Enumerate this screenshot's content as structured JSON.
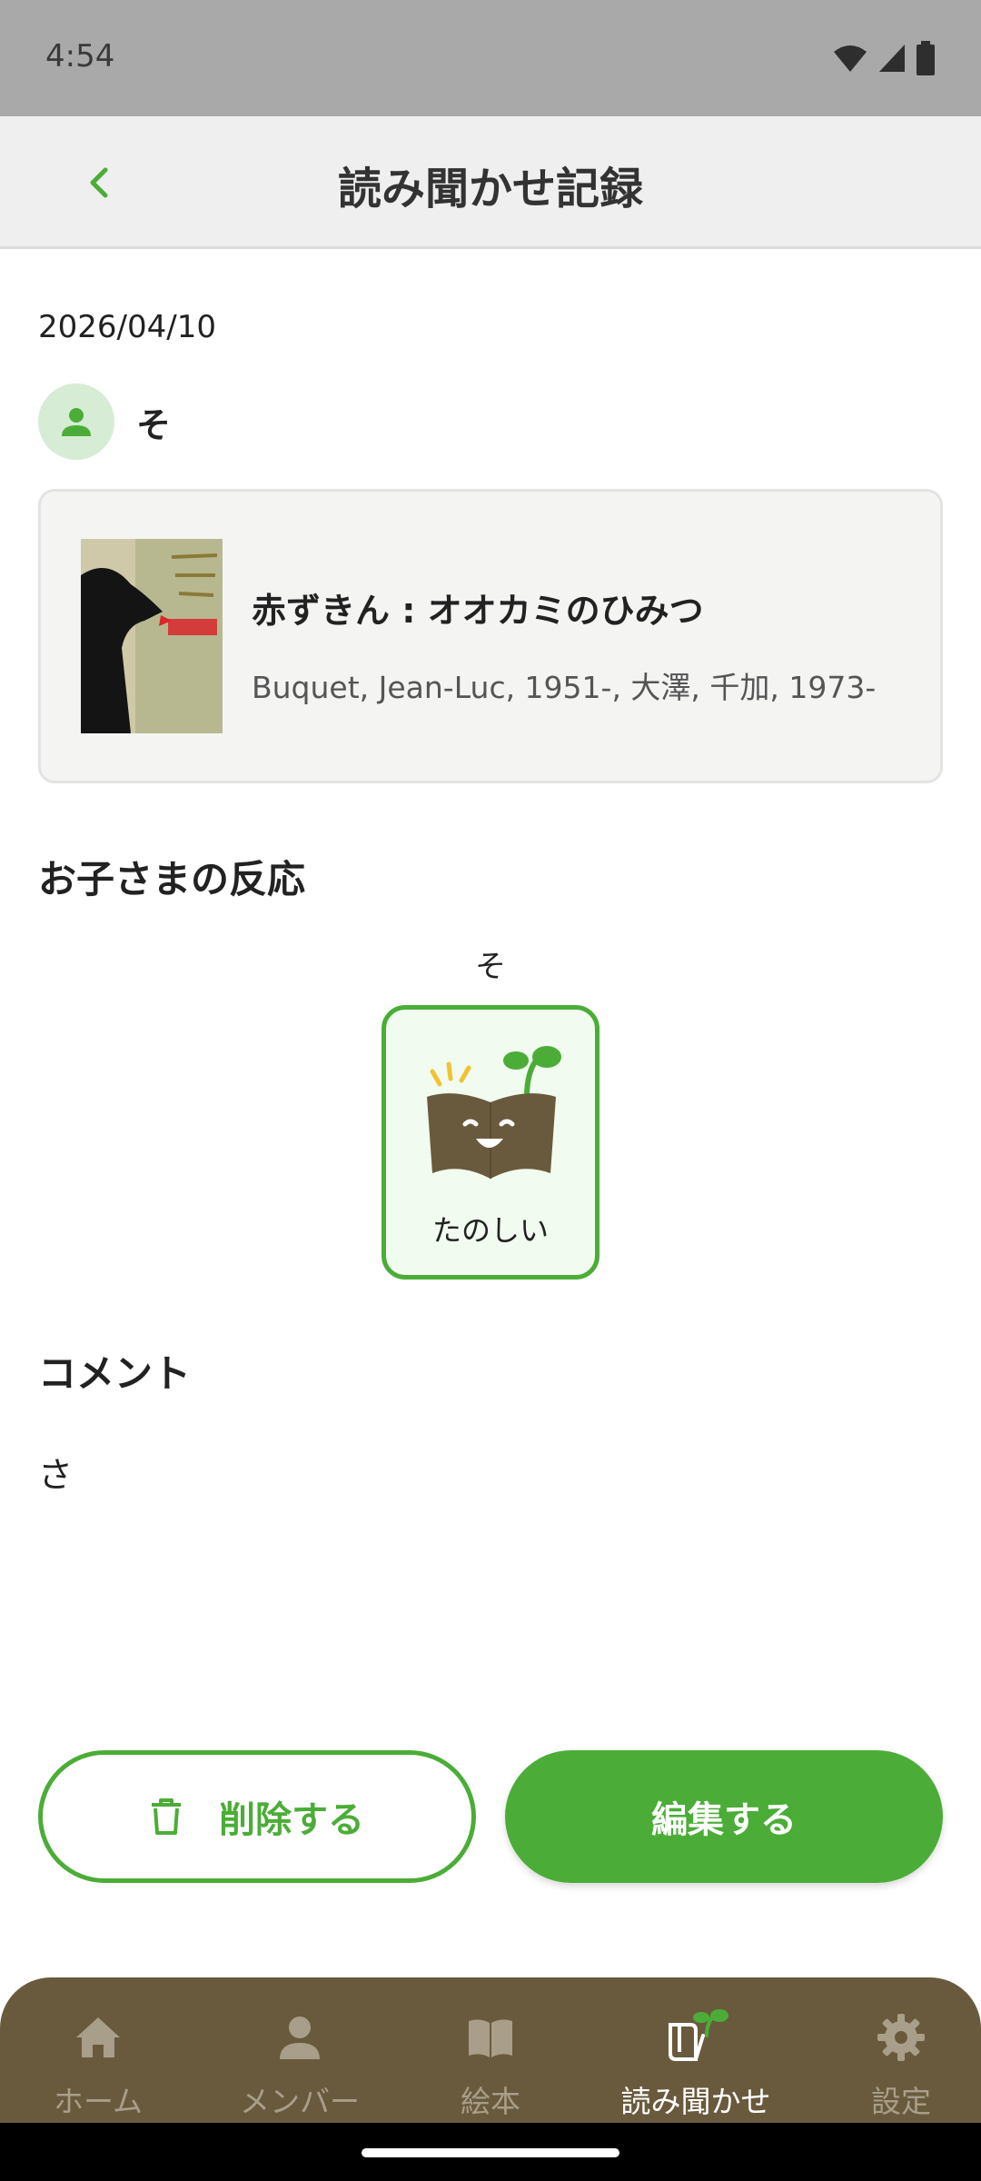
{
  "status_bar": {
    "time": "4:54"
  },
  "app_bar": {
    "title": "読み聞かせ記録"
  },
  "record": {
    "date": "2026/04/10",
    "member_name": "そ"
  },
  "book": {
    "title": "赤ずきん : オオカミのひみつ",
    "author": "Buquet, Jean-Luc, 1951-, 大澤, 千加, 1973-"
  },
  "reactions": {
    "heading": "お子さまの反応",
    "member_name": "そ",
    "reaction_label": "たのしい"
  },
  "comment": {
    "heading": "コメント",
    "text": "さ"
  },
  "actions": {
    "delete_label": "削除する",
    "edit_label": "編集する"
  },
  "bottom_nav": {
    "items": [
      {
        "label": "ホーム",
        "icon": "home-icon"
      },
      {
        "label": "メンバー",
        "icon": "person-icon"
      },
      {
        "label": "絵本",
        "icon": "book-icon"
      },
      {
        "label": "読み聞かせ",
        "icon": "reading-sprout-icon",
        "active": true
      },
      {
        "label": "設定",
        "icon": "gear-icon"
      }
    ]
  },
  "colors": {
    "accent": "#4bad37",
    "nav_background": "#6a5a3d",
    "app_bar_background": "#efefef",
    "status_bar_background": "#a9a9a9"
  }
}
